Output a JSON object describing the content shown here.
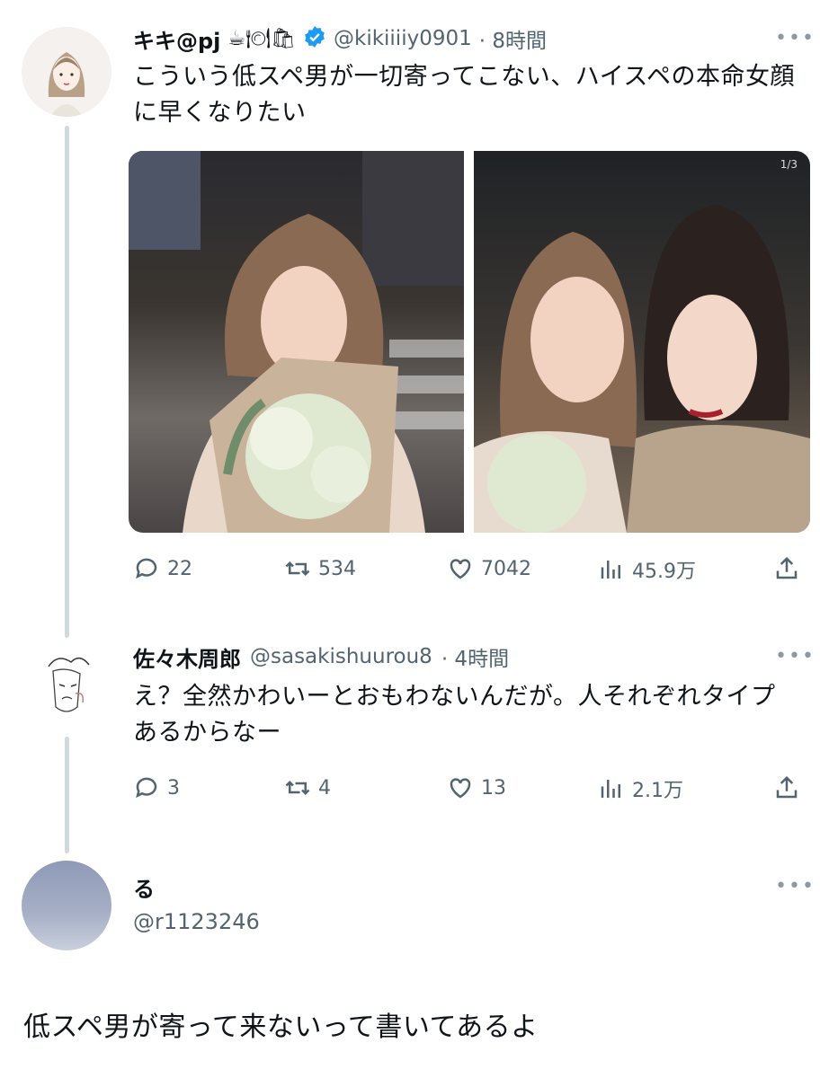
{
  "tweet1": {
    "name": "キキ@pj",
    "name_emojis": "☕🍽🛍",
    "handle": "@kikiiiiy0901",
    "time": "· 8時間",
    "text": "こういう低スペ男が一切寄ってこない、ハイスペの本命女顔に早くなりたい",
    "counter_badge": "1/3",
    "replies": "22",
    "retweets": "534",
    "likes": "7042",
    "views": "45.9万"
  },
  "tweet2": {
    "name": "佐々木周郎",
    "handle": "@sasakishuurou8",
    "time": "· 4時間",
    "text": "え？全然かわいーとおもわないんだが。人それぞれタイプあるからなー",
    "replies": "3",
    "retweets": "4",
    "likes": "13",
    "views": "2.1万"
  },
  "tweet3": {
    "name": "る",
    "handle": "@r1123246",
    "text": "低スペ男が寄って来ないって書いてあるよ"
  },
  "colors": {
    "verified": "#1d9bf0",
    "secondary": "#536471",
    "thread_line": "#cfd9de"
  },
  "icons": {
    "more": "more-dots-icon",
    "reply": "reply-bubble-icon",
    "retweet": "retweet-icon",
    "like": "heart-icon",
    "views": "views-bar-icon",
    "share": "share-icon",
    "verified": "verified-badge-icon"
  }
}
